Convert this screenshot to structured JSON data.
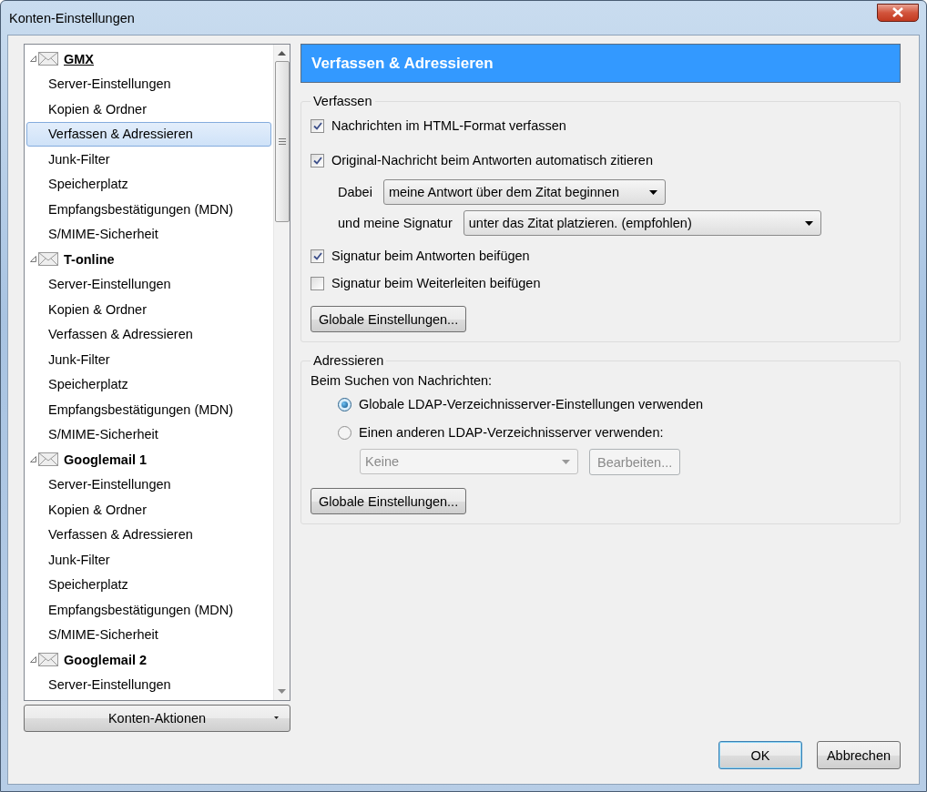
{
  "window": {
    "title": "Konten-Einstellungen"
  },
  "accounts": [
    {
      "name": "GMX",
      "expanded": true,
      "focused": true,
      "children": [
        {
          "label": "Server-Einstellungen",
          "selected": false
        },
        {
          "label": "Kopien & Ordner",
          "selected": false
        },
        {
          "label": "Verfassen & Adressieren",
          "selected": true
        },
        {
          "label": "Junk-Filter",
          "selected": false
        },
        {
          "label": "Speicherplatz",
          "selected": false
        },
        {
          "label": "Empfangsbestätigungen (MDN)",
          "selected": false
        },
        {
          "label": "S/MIME-Sicherheit",
          "selected": false
        }
      ]
    },
    {
      "name": "T-online",
      "expanded": true,
      "focused": false,
      "children": [
        {
          "label": "Server-Einstellungen",
          "selected": false
        },
        {
          "label": "Kopien & Ordner",
          "selected": false
        },
        {
          "label": "Verfassen & Adressieren",
          "selected": false
        },
        {
          "label": "Junk-Filter",
          "selected": false
        },
        {
          "label": "Speicherplatz",
          "selected": false
        },
        {
          "label": "Empfangsbestätigungen (MDN)",
          "selected": false
        },
        {
          "label": "S/MIME-Sicherheit",
          "selected": false
        }
      ]
    },
    {
      "name": "Googlemail 1",
      "expanded": true,
      "focused": false,
      "children": [
        {
          "label": "Server-Einstellungen",
          "selected": false
        },
        {
          "label": "Kopien & Ordner",
          "selected": false
        },
        {
          "label": "Verfassen & Adressieren",
          "selected": false
        },
        {
          "label": "Junk-Filter",
          "selected": false
        },
        {
          "label": "Speicherplatz",
          "selected": false
        },
        {
          "label": "Empfangsbestätigungen (MDN)",
          "selected": false
        },
        {
          "label": "S/MIME-Sicherheit",
          "selected": false
        }
      ]
    },
    {
      "name": "Googlemail 2",
      "expanded": true,
      "focused": false,
      "children": [
        {
          "label": "Server-Einstellungen",
          "selected": false
        }
      ]
    }
  ],
  "account_actions": {
    "label": "Konten-Aktionen"
  },
  "panel": {
    "title": "Verfassen & Adressieren"
  },
  "compose": {
    "legend": "Verfassen",
    "items": [
      {
        "kind": "checkbox",
        "label": "Nachrichten im HTML-Format verfassen",
        "checked": true
      },
      {
        "kind": "checkbox",
        "label": "Original-Nachricht beim Antworten automatisch zitieren",
        "checked": true
      },
      {
        "kind": "select",
        "label": "Dabei",
        "value": "meine Antwort über dem Zitat beginnen"
      },
      {
        "kind": "select",
        "label": "und meine Signatur",
        "value": "unter das Zitat platzieren. (empfohlen)"
      },
      {
        "kind": "checkbox",
        "label": "Signatur beim Antworten beifügen",
        "checked": true
      },
      {
        "kind": "checkbox",
        "label": "Signatur beim Weiterleiten beifügen",
        "checked": false
      }
    ],
    "button": "Globale Einstellungen..."
  },
  "addressing": {
    "legend": "Adressieren",
    "prompt": "Beim Suchen von Nachrichten:",
    "options": [
      {
        "label": "Globale LDAP-Verzeichnisserver-Einstellungen verwenden",
        "selected": true
      },
      {
        "label": "Einen anderen LDAP-Verzeichnisserver verwenden:",
        "selected": false
      }
    ],
    "directory": {
      "value": "Keine",
      "disabled": true
    },
    "edit_button": {
      "label": "Bearbeiten...",
      "disabled": true
    },
    "button": "Globale Einstellungen..."
  },
  "buttons": [
    {
      "label": "OK",
      "default": true
    },
    {
      "label": "Abbrechen",
      "default": false
    }
  ]
}
